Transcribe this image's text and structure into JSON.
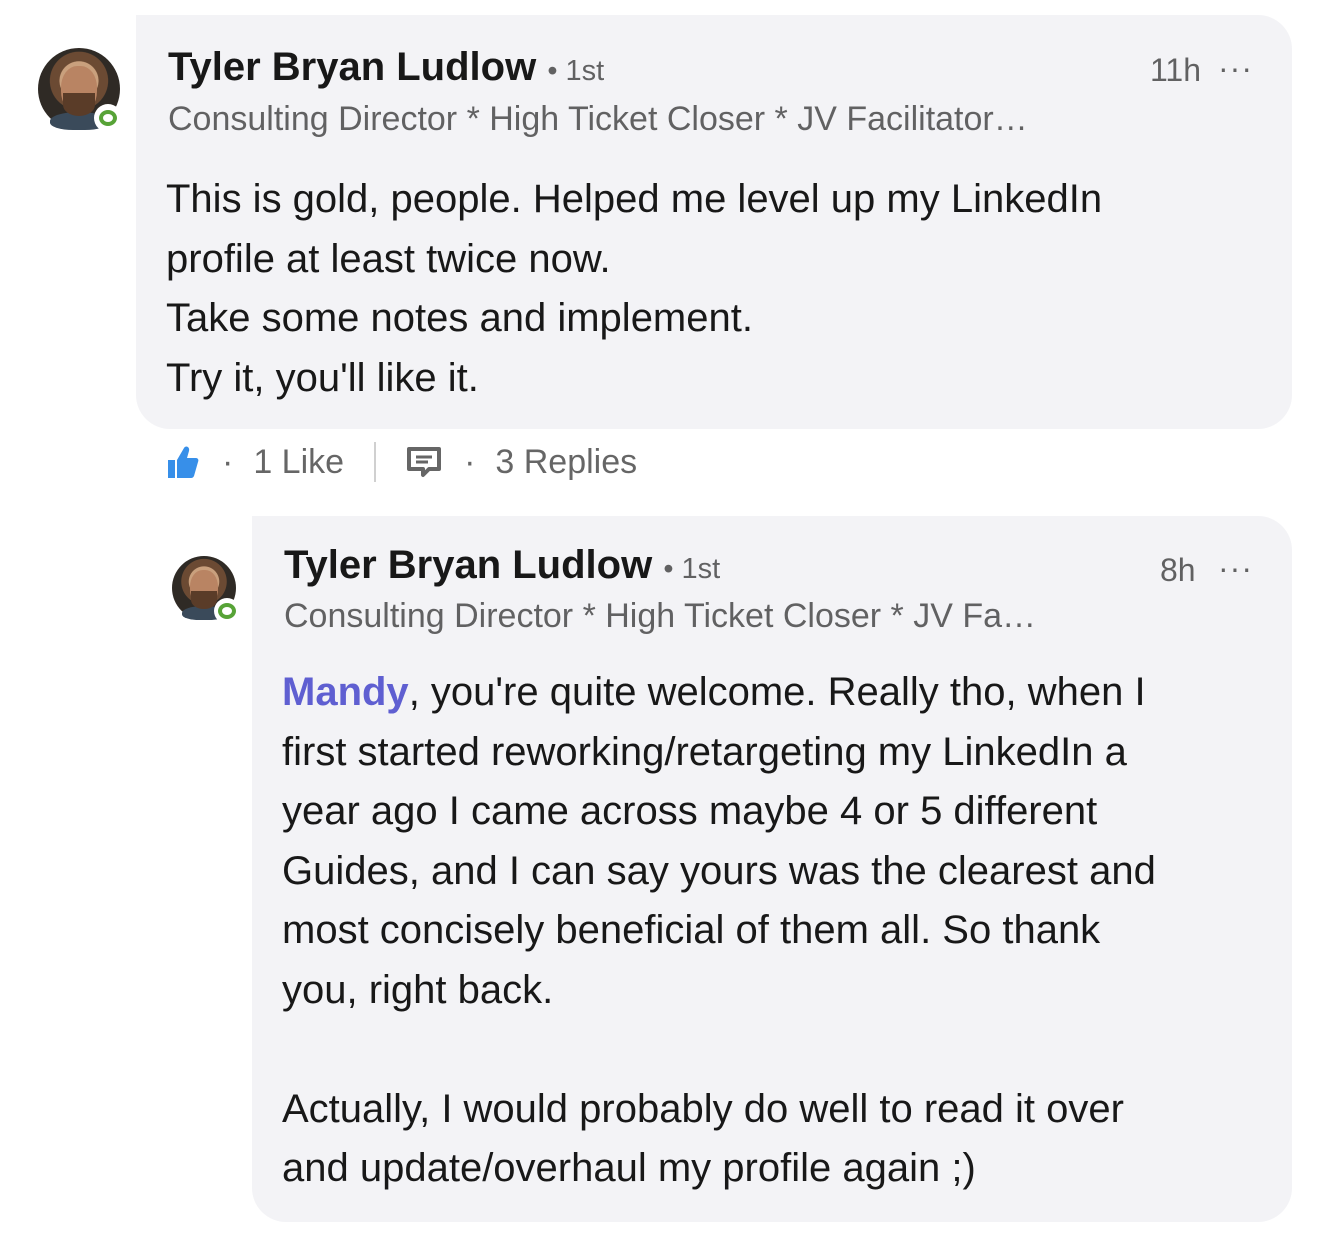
{
  "comment": {
    "author_name": "Tyler Bryan Ludlow",
    "degree_prefix": "•",
    "degree": "1st",
    "headline": "Consulting Director * High Ticket Closer * JV Facilitator…",
    "time": "11h",
    "more_label": "···",
    "body": [
      "This is gold, people. Helped me level up my LinkedIn",
      "profile at least twice now.",
      "Take some notes and implement.",
      "Try it, you'll like it."
    ],
    "like_dot": "·",
    "like_label": "1 Like",
    "reply_dot": "·",
    "replies_label": "3 Replies"
  },
  "reply": {
    "author_name": "Tyler Bryan Ludlow",
    "degree_prefix": "•",
    "degree": "1st",
    "headline": "Consulting Director * High Ticket Closer * JV Fa…",
    "time": "8h",
    "more_label": "···",
    "mention": "Mandy",
    "body_first_rest": ", you're quite welcome. Really tho, when I",
    "body": [
      "first started reworking/retargeting my LinkedIn a",
      "year ago I came across maybe 4 or 5 different",
      "Guides, and I can say yours was the clearest and",
      "most concisely beneficial of them all. So thank",
      "you, right back."
    ],
    "body2": [
      "Actually, I would probably do well to read it over",
      "and update/overhaul my profile again ;)"
    ]
  },
  "colors": {
    "bubble_bg": "#f3f3f6",
    "mention": "#5f5fd1",
    "like_icon": "#378fe9",
    "presence": "#57a337"
  },
  "icons": {
    "like": "thumbs-up-icon",
    "reply": "comment-icon",
    "presence": "online-presence-icon"
  }
}
